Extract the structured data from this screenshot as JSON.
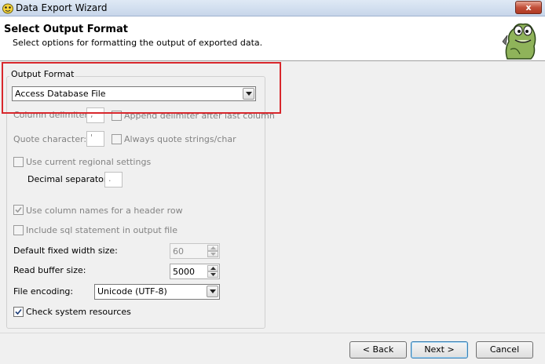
{
  "window": {
    "title": "Data Export Wizard",
    "close_label": "x"
  },
  "header": {
    "title": "Select Output Format",
    "subtitle": "Select options for formatting the output of exported data."
  },
  "output_format": {
    "group_label": "Output Format",
    "selected": "Access Database File"
  },
  "options": {
    "column_delimiter_label": "Column delimiter:",
    "column_delimiter_value": ",",
    "append_delimiter_label": "Append delimiter after last column",
    "quote_character_label": "Quote character:",
    "quote_character_value": "'",
    "always_quote_label": "Always quote strings/char",
    "regional_settings_label": "Use current regional settings",
    "decimal_separator_label": "Decimal separator:",
    "decimal_separator_value": ".",
    "column_names_header_label": "Use column names for a header row",
    "include_sql_label": "Include sql statement in output file",
    "default_fixed_width_label": "Default fixed width size:",
    "default_fixed_width_value": "60",
    "read_buffer_label": "Read buffer size:",
    "read_buffer_value": "5000",
    "file_encoding_label": "File encoding:",
    "file_encoding_value": "Unicode (UTF-8)",
    "check_resources_label": "Check system resources"
  },
  "state": {
    "append_delimiter_checked": false,
    "always_quote_checked": false,
    "regional_settings_checked": false,
    "column_names_header_checked": true,
    "include_sql_checked": false,
    "check_resources_checked": true
  },
  "buttons": {
    "back": "< Back",
    "next": "Next >",
    "cancel": "Cancel"
  },
  "colors": {
    "highlight": "#d8272c",
    "header_bg": "#ffffff",
    "window_bg": "#f0f0f0"
  }
}
